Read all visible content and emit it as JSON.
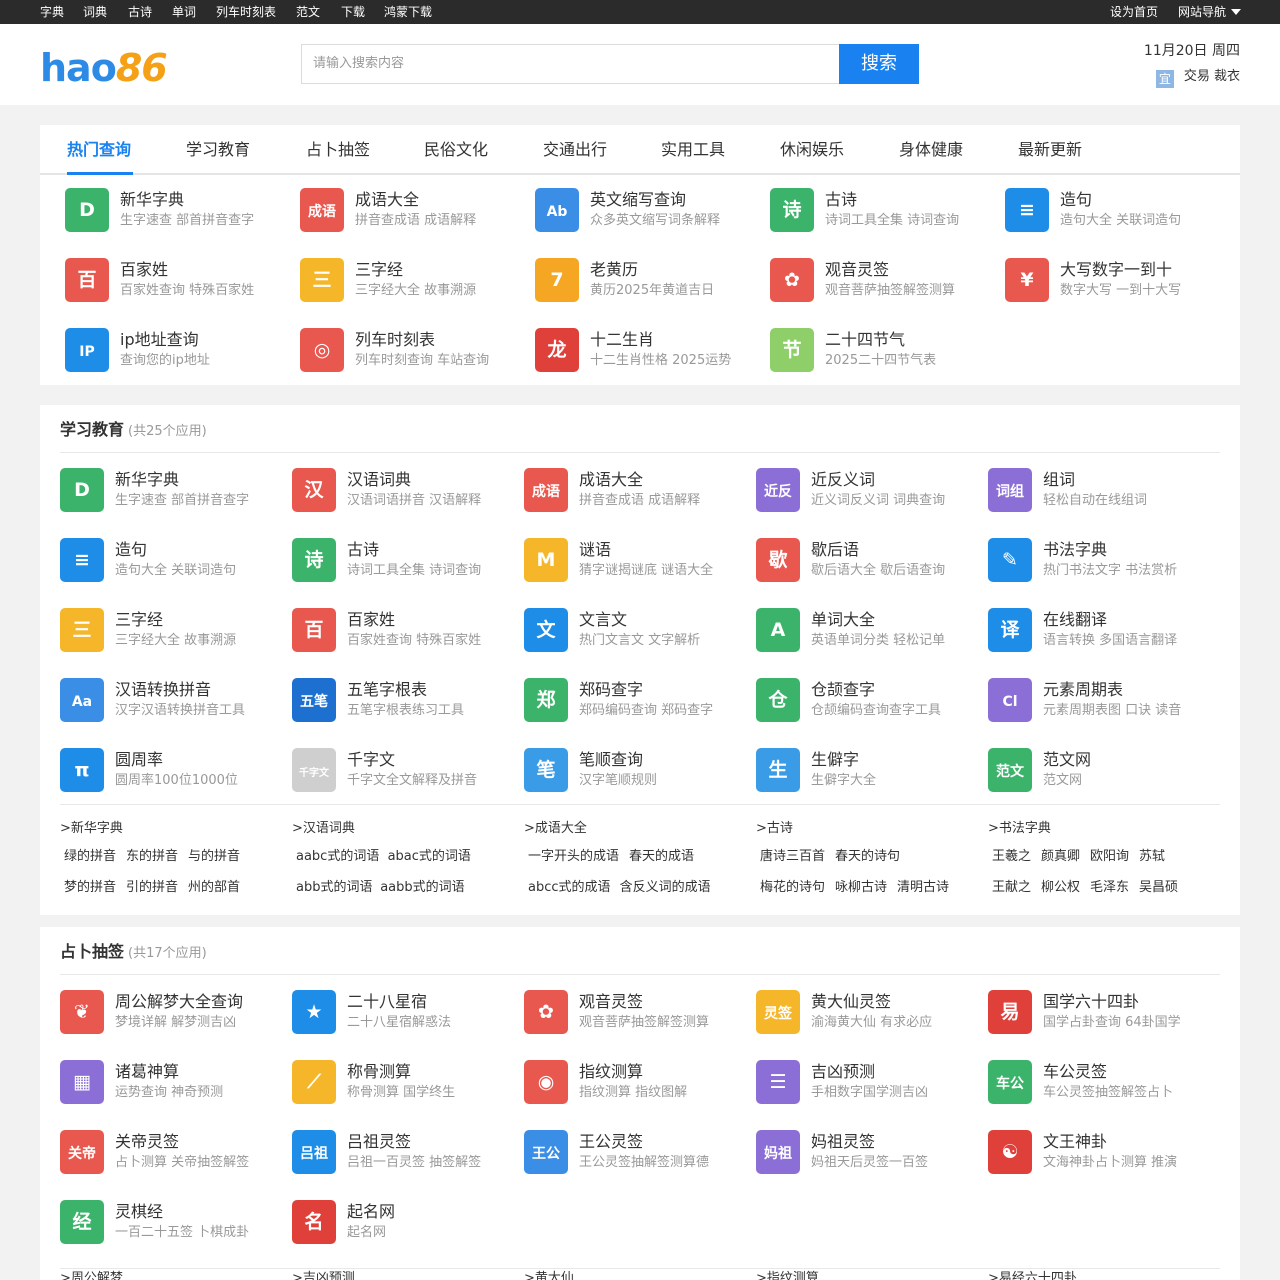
{
  "topnav": {
    "links": [
      "字典",
      "词典",
      "古诗",
      "单词",
      "列车时刻表",
      "范文",
      "下载",
      "鸿蒙下载"
    ],
    "set_home": "设为首页",
    "site_nav": "网站导航"
  },
  "header": {
    "logo_part1": "hao",
    "logo_part2": "86",
    "search_placeholder": "请输入搜索内容",
    "search_button": "搜索",
    "date": "11月20日 周四",
    "almanac_badge": "宜",
    "almanac_text": "交易 裁衣"
  },
  "hot": {
    "tabs": [
      "热门查询",
      "学习教育",
      "占卜抽签",
      "民俗文化",
      "交通出行",
      "实用工具",
      "休闲娱乐",
      "身体健康",
      "最新更新"
    ],
    "apps": [
      {
        "name": "新华字典",
        "desc": "生字速查 部首拼音查字",
        "icon": "D",
        "color": "#3bb36a"
      },
      {
        "name": "成语大全",
        "desc": "拼音查成语 成语解释",
        "icon": "成语",
        "color": "#e9584f"
      },
      {
        "name": "英文缩写查询",
        "desc": "众多英文缩写词条解释",
        "icon": "Ab",
        "color": "#3a8ee6"
      },
      {
        "name": "古诗",
        "desc": "诗词工具全集 诗词查询",
        "icon": "诗",
        "color": "#3bb36a"
      },
      {
        "name": "造句",
        "desc": "造句大全 关联词造句",
        "icon": "≡",
        "color": "#1e8de8"
      },
      {
        "name": "百家姓",
        "desc": "百家姓查询 特殊百家姓",
        "icon": "百",
        "color": "#e9584f"
      },
      {
        "name": "三字经",
        "desc": "三字经大全 故事溯源",
        "icon": "三",
        "color": "#f5b62a"
      },
      {
        "name": "老黄历",
        "desc": "黄历2025年黄道吉日",
        "icon": "7",
        "color": "#f5a623"
      },
      {
        "name": "观音灵签",
        "desc": "观音菩萨抽签解签测算",
        "icon": "✿",
        "color": "#e9584f"
      },
      {
        "name": "大写数字一到十",
        "desc": "数字大写 一到十大写",
        "icon": "¥",
        "color": "#e9584f"
      },
      {
        "name": "ip地址查询",
        "desc": "查询您的ip地址",
        "icon": "IP",
        "color": "#1e8de8"
      },
      {
        "name": "列车时刻表",
        "desc": "列车时刻查询 车站查询",
        "icon": "◎",
        "color": "#e9584f"
      },
      {
        "name": "十二生肖",
        "desc": "十二生肖性格 2025运势",
        "icon": "龙",
        "color": "#e0403a"
      },
      {
        "name": "二十四节气",
        "desc": "2025二十四节气表",
        "icon": "节",
        "color": "#8fcf6a"
      }
    ]
  },
  "study": {
    "title": "学习教育",
    "count": "(共25个应用)",
    "apps": [
      {
        "name": "新华字典",
        "desc": "生字速查 部首拼音查字",
        "icon": "D",
        "color": "#3bb36a"
      },
      {
        "name": "汉语词典",
        "desc": "汉语词语拼音 汉语解释",
        "icon": "汉",
        "color": "#e9584f"
      },
      {
        "name": "成语大全",
        "desc": "拼音查成语 成语解释",
        "icon": "成语",
        "color": "#e9584f"
      },
      {
        "name": "近反义词",
        "desc": "近义词反义词 词典查询",
        "icon": "近反",
        "color": "#8b6fd6"
      },
      {
        "name": "组词",
        "desc": "轻松自动在线组词",
        "icon": "词组",
        "color": "#8b6fd6"
      },
      {
        "name": "造句",
        "desc": "造句大全 关联词造句",
        "icon": "≡",
        "color": "#1e8de8"
      },
      {
        "name": "古诗",
        "desc": "诗词工具全集 诗词查询",
        "icon": "诗",
        "color": "#3bb36a"
      },
      {
        "name": "谜语",
        "desc": "猜字谜揭谜底 谜语大全",
        "icon": "M",
        "color": "#f5b62a"
      },
      {
        "name": "歇后语",
        "desc": "歇后语大全 歇后语查询",
        "icon": "歇",
        "color": "#e9584f"
      },
      {
        "name": "书法字典",
        "desc": "热门书法文字 书法赏析",
        "icon": "✎",
        "color": "#1e8de8"
      },
      {
        "name": "三字经",
        "desc": "三字经大全 故事溯源",
        "icon": "三",
        "color": "#f5b62a"
      },
      {
        "name": "百家姓",
        "desc": "百家姓查询 特殊百家姓",
        "icon": "百",
        "color": "#e9584f"
      },
      {
        "name": "文言文",
        "desc": "热门文言文 文字解析",
        "icon": "文",
        "color": "#1e8de8"
      },
      {
        "name": "单词大全",
        "desc": "英语单词分类 轻松记单",
        "icon": "A",
        "color": "#3bb36a"
      },
      {
        "name": "在线翻译",
        "desc": "语言转换 多国语言翻译",
        "icon": "译",
        "color": "#1e8de8"
      },
      {
        "name": "汉语转换拼音",
        "desc": "汉字汉语转换拼音工具",
        "icon": "Aa",
        "color": "#3a8ee6"
      },
      {
        "name": "五笔字根表",
        "desc": "五笔字根表练习工具",
        "icon": "五笔",
        "color": "#1e70d0"
      },
      {
        "name": "郑码查字",
        "desc": "郑码编码查询 郑码查字",
        "icon": "郑",
        "color": "#3bb36a"
      },
      {
        "name": "仓颉查字",
        "desc": "仓颉编码查询查字工具",
        "icon": "仓",
        "color": "#3bb36a"
      },
      {
        "name": "元素周期表",
        "desc": "元素周期表图 口诀 读音",
        "icon": "Cl",
        "color": "#8b6fd6"
      },
      {
        "name": "圆周率",
        "desc": "圆周率100位1000位",
        "icon": "π",
        "color": "#1e8de8"
      },
      {
        "name": "千字文",
        "desc": "千字文全文解释及拼音",
        "icon": "千字文",
        "color": "#cfcfcf"
      },
      {
        "name": "笔顺查询",
        "desc": "汉字笔顺规则",
        "icon": "笔",
        "color": "#3a9be6"
      },
      {
        "name": "生僻字",
        "desc": "生僻字大全",
        "icon": "生",
        "color": "#3a9be6"
      },
      {
        "name": "范文网",
        "desc": "范文网",
        "icon": "范文",
        "color": "#3bb36a"
      }
    ],
    "keywords": [
      {
        "cat": ">新华字典",
        "rows": [
          [
            "绿的拼音",
            "东的拼音",
            "与的拼音"
          ],
          [
            "梦的拼音",
            "引的拼音",
            "州的部首"
          ]
        ]
      },
      {
        "cat": ">汉语词典",
        "rows": [
          [
            "aabc式的词语",
            "abac式的词语"
          ],
          [
            "abb式的词语",
            "aabb式的词语"
          ]
        ]
      },
      {
        "cat": ">成语大全",
        "rows": [
          [
            "一字开头的成语",
            "春天的成语"
          ],
          [
            "abcc式的成语",
            "含反义词的成语"
          ]
        ]
      },
      {
        "cat": ">古诗",
        "rows": [
          [
            "唐诗三百首",
            "春天的诗句"
          ],
          [
            "梅花的诗句",
            "咏柳古诗",
            "清明古诗"
          ]
        ]
      },
      {
        "cat": ">书法字典",
        "rows": [
          [
            "王羲之",
            "颜真卿",
            "欧阳询",
            "苏轼"
          ],
          [
            "王献之",
            "柳公权",
            "毛泽东",
            "吴昌硕"
          ]
        ]
      }
    ]
  },
  "divine": {
    "title": "占卜抽签",
    "count": "(共17个应用)",
    "apps": [
      {
        "name": "周公解梦大全查询",
        "desc": "梦境详解 解梦测吉凶",
        "icon": "❦",
        "color": "#e9584f"
      },
      {
        "name": "二十八星宿",
        "desc": "二十八星宿解惑法",
        "icon": "★",
        "color": "#1e8de8"
      },
      {
        "name": "观音灵签",
        "desc": "观音菩萨抽签解签测算",
        "icon": "✿",
        "color": "#e9584f"
      },
      {
        "name": "黄大仙灵签",
        "desc": "渝海黄大仙 有求必应",
        "icon": "灵签",
        "color": "#f5b62a"
      },
      {
        "name": "国学六十四卦",
        "desc": "国学占卦查询 64卦国学",
        "icon": "易",
        "color": "#e0403a"
      },
      {
        "name": "诸葛神算",
        "desc": "运势查询 神奇预测",
        "icon": "▦",
        "color": "#8b6fd6"
      },
      {
        "name": "称骨测算",
        "desc": "称骨测算 国学终生",
        "icon": "⟋",
        "color": "#f5b62a"
      },
      {
        "name": "指纹测算",
        "desc": "指纹测算 指纹图解",
        "icon": "◉",
        "color": "#e9584f"
      },
      {
        "name": "吉凶预测",
        "desc": "手相数字国学测吉凶",
        "icon": "☰",
        "color": "#8b6fd6"
      },
      {
        "name": "车公灵签",
        "desc": "车公灵签抽签解签占卜",
        "icon": "车公",
        "color": "#3bb36a"
      },
      {
        "name": "关帝灵签",
        "desc": "占卜测算 关帝抽签解签",
        "icon": "关帝",
        "color": "#e9584f"
      },
      {
        "name": "吕祖灵签",
        "desc": "吕祖一百灵签 抽签解签",
        "icon": "吕祖",
        "color": "#1e8de8"
      },
      {
        "name": "王公灵签",
        "desc": "王公灵签抽解签测算德",
        "icon": "王公",
        "color": "#3a8ee6"
      },
      {
        "name": "妈祖灵签",
        "desc": "妈祖天后灵签一百签",
        "icon": "妈祖",
        "color": "#8b6fd6"
      },
      {
        "name": "文王神卦",
        "desc": "文海神卦占卜测算 推演",
        "icon": "☯",
        "color": "#e0403a"
      },
      {
        "name": "灵棋经",
        "desc": "一百二十五签 卜棋成卦",
        "icon": "经",
        "color": "#3bb36a"
      },
      {
        "name": "起名网",
        "desc": "起名网",
        "icon": "名",
        "color": "#e0403a"
      }
    ],
    "keyword_cats": [
      ">周公解梦",
      ">吉凶预测",
      ">黄大仙",
      ">指纹测算",
      ">易经六十四卦"
    ]
  }
}
